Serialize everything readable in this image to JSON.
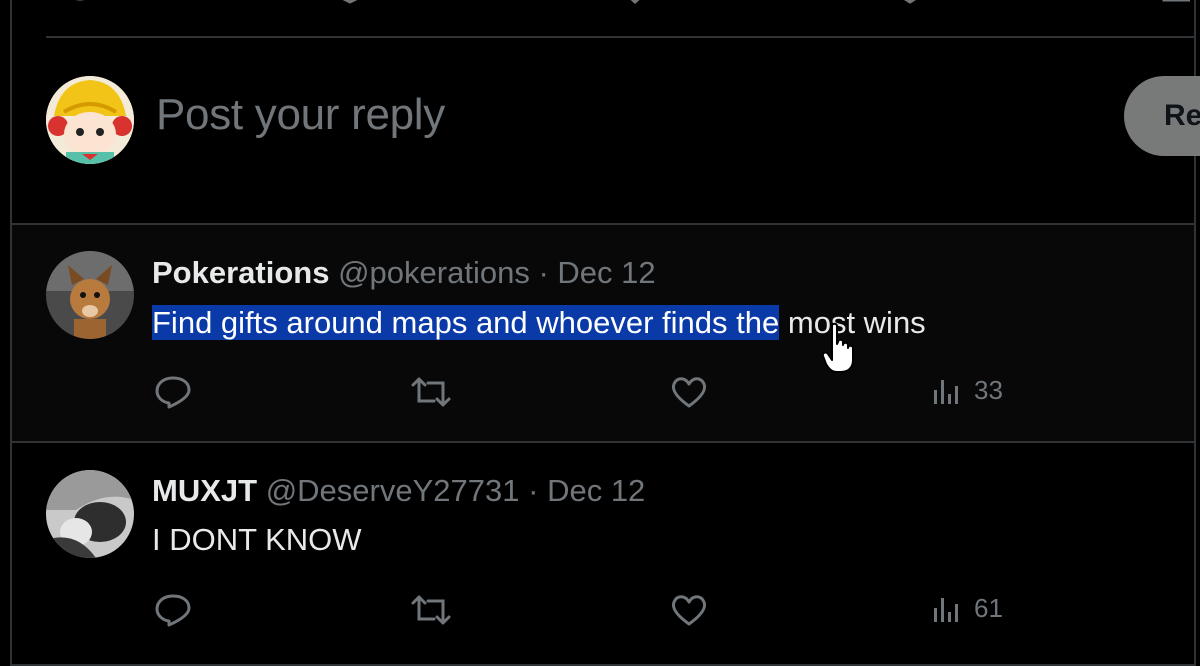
{
  "composer": {
    "placeholder": "Post your reply",
    "reply_button_label": "Reply",
    "reply_button_visible": "Re"
  },
  "tweets": [
    {
      "name": "Pokerations",
      "handle": "@pokerations",
      "dot": "·",
      "date": "Dec 12",
      "text_selected": "Find gifts around maps and whoever finds the",
      "text_rest": " most wins",
      "views": "33"
    },
    {
      "name": "MUXJT",
      "handle": "@DeserveY27731",
      "dot": "·",
      "date": "Dec 12",
      "text_selected": "",
      "text_rest": "I DONT KNOW",
      "views": "61"
    }
  ],
  "icons": {
    "reply": "reply-icon",
    "repost": "repost-icon",
    "like": "heart-icon",
    "views": "views-chart-icon"
  },
  "colors": {
    "background": "#000000",
    "text_primary": "#e7e9ea",
    "text_secondary": "#71767b",
    "divider": "#2f3336",
    "selection": "#0a3aa8"
  }
}
